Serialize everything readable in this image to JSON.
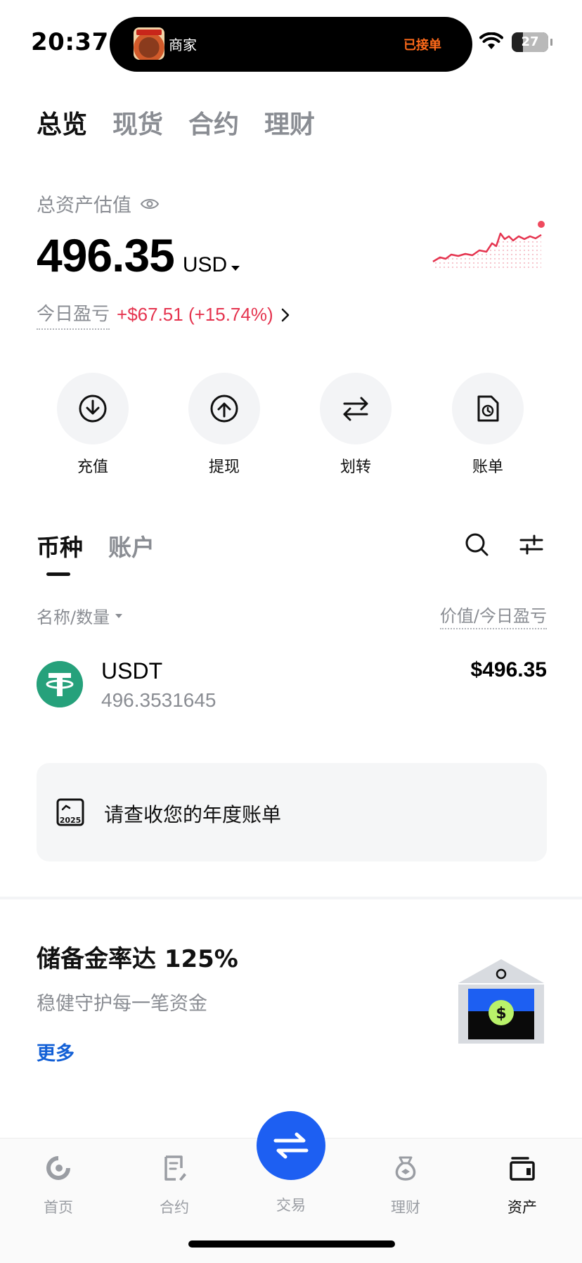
{
  "status_bar": {
    "time": "20:37",
    "island_title": "商家",
    "island_status": "已接单",
    "battery": "27"
  },
  "top_tabs": [
    "总览",
    "现货",
    "合约",
    "理财"
  ],
  "summary": {
    "label": "总资产估值",
    "balance": "496.35",
    "currency": "USD",
    "pnl_label": "今日盈亏",
    "pnl_value": "+$67.51 (+15.74%)",
    "accent_positive_color": "#e5344f"
  },
  "actions": [
    {
      "label": "充值",
      "icon": "download-icon"
    },
    {
      "label": "提现",
      "icon": "upload-icon"
    },
    {
      "label": "划转",
      "icon": "transfer-icon"
    },
    {
      "label": "账单",
      "icon": "bill-icon"
    }
  ],
  "sub_tabs": [
    "币种",
    "账户"
  ],
  "list": {
    "left_header": "名称/数量",
    "right_header": "价值/今日盈亏",
    "assets": [
      {
        "symbol": "USDT",
        "amount": "496.3531645",
        "value": "$496.35",
        "logo_color": "#26a17b"
      }
    ]
  },
  "annual_card": {
    "icon_year": "2025",
    "text": "请查收您的年度账单"
  },
  "reserve": {
    "title": "储备金率达 125%",
    "subtitle": "稳健守护每一笔资金",
    "more": "更多"
  },
  "bottom_nav": {
    "items": [
      {
        "label": "首页",
        "icon": "home-icon"
      },
      {
        "label": "合约",
        "icon": "contract-icon"
      },
      {
        "label": "交易",
        "icon": "trade-icon"
      },
      {
        "label": "理财",
        "icon": "finance-icon"
      },
      {
        "label": "资产",
        "icon": "wallet-icon"
      }
    ],
    "active": "资产",
    "trade_button_color": "#1d5ff2"
  }
}
